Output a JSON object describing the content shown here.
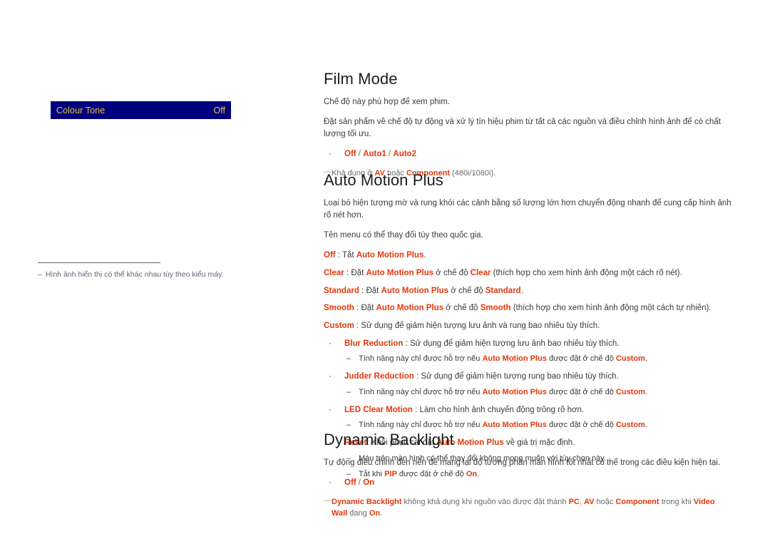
{
  "osd": {
    "label": "Colour Tone",
    "value": "Off",
    "bg_color": "#00007f",
    "text_color": "#e8c23c"
  },
  "left_note": {
    "marker": "–",
    "text": "Hình ảnh hiển thị có thể khác nhau tùy theo kiểu máy."
  },
  "accent_colors": {
    "red": "#e3380c",
    "grey": "#6a6a6a",
    "menu_blue": "#00007f",
    "menu_yellow": "#e8c23c"
  },
  "sections": {
    "film_mode": {
      "title": "Film Mode",
      "p1": "Chế độ này phù hợp để xem phim.",
      "p2": "Đặt sản phẩm về chế độ tự động và xử lý tín hiệu phim từ tất cả các nguồn và điều chỉnh hình ảnh để có chất lượng tối ưu.",
      "bullet_marker": "·",
      "options": {
        "o1": "Off",
        "sep1": " / ",
        "o2": "Auto1",
        "sep2": " / ",
        "o3": "Auto2"
      },
      "footnote": {
        "marker": "—",
        "t1": "Khả dụng ở ",
        "k1": "AV",
        "t2": " hoặc ",
        "k2": "Component",
        "t3": " (480i/1080i)."
      }
    },
    "auto_motion_plus": {
      "title": "Auto Motion Plus",
      "p1": "Loại bỏ hiện tượng mờ và rung khỏi các cảnh bằng số lượng lớn hơn chuyển động nhanh để cung cấp hình ảnh rõ nét hơn.",
      "p2": "Tên menu có thể thay đổi tùy theo quốc gia.",
      "defs": {
        "off": {
          "key": "Off",
          "sep": " : ",
          "t1": "Tắt ",
          "k1": "Auto Motion Plus",
          "t2": "."
        },
        "clear": {
          "key": "Clear",
          "sep": " : ",
          "t1": "Đặt ",
          "k1": "Auto Motion Plus",
          "t2": " ở chế độ ",
          "k2": "Clear",
          "t3": " (thích hợp cho xem hình ảnh động một cách rõ nét)."
        },
        "standard": {
          "key": "Standard",
          "sep": " : ",
          "t1": "Đặt ",
          "k1": "Auto Motion Plus",
          "t2": " ở chế độ ",
          "k2": "Standard",
          "t3": "."
        },
        "smooth": {
          "key": "Smooth",
          "sep": " : ",
          "t1": "Đặt ",
          "k1": "Auto Motion Plus",
          "t2": " ở chế độ ",
          "k2": "Smooth",
          "t3": " (thích hợp cho xem hình ảnh động một cách tự nhiên)."
        },
        "custom": {
          "key": "Custom",
          "sep": " : ",
          "t1": "Sử dụng để giảm hiện tượng lưu ảnh và rung bao nhiêu tùy thích."
        }
      },
      "bullet_marker": "·",
      "dash_marker": "–",
      "sub_items": {
        "blur": {
          "key": "Blur Reduction",
          "sep": " : ",
          "text": "Sử dụng để giảm hiện tượng lưu ảnh bao nhiêu tùy thích."
        },
        "judder": {
          "key": "Judder Reduction",
          "sep": " : ",
          "text": "Sử dụng để giảm hiện tượng rung bao nhiêu tùy thích."
        },
        "led": {
          "key": "LED Clear Motion",
          "sep": " : ",
          "text": "Làm cho hình ảnh chuyển động trông rõ hơn."
        },
        "reset": {
          "key": "Reset",
          "sep": ": ",
          "t1": "Khôi phục cài đặt ",
          "k1": "Auto Motion Plus",
          "t2": " về giá trị mặc định."
        }
      },
      "notes": {
        "custom_support": {
          "t1": "Tính năng này chỉ được hỗ trợ nếu ",
          "k1": "Auto Motion Plus",
          "t2": " được đặt ở chế độ ",
          "k2": "Custom",
          "t3": "."
        },
        "colour_change": {
          "text": "Màu trên màn hình có thể thay đổi không mong muốn với tùy chọn này."
        },
        "pip_off": {
          "t1": "Tắt khi ",
          "k1": "PIP",
          "t2": " được đặt ở chế độ ",
          "k2": "On",
          "t3": "."
        }
      }
    },
    "dynamic_backlight": {
      "title": "Dynamic Backlight",
      "p1": "Tự động điều chỉnh đèn nền để mang lại độ tương phản màn hình tốt nhất có thể trong các điều kiện hiện tại.",
      "bullet_marker": "·",
      "options": {
        "o1": "Off",
        "sep1": " / ",
        "o2": "On"
      },
      "footnote": {
        "marker": "—",
        "k1": "Dynamic Backlight",
        "t1": " không khả dụng khi nguồn vào được đặt thành ",
        "k2": "PC",
        "t2": ", ",
        "k3": "AV",
        "t3": " hoặc ",
        "k4": "Component",
        "t4": " trong khi ",
        "k5": "Video Wall",
        "t5": " đang ",
        "k6": "On",
        "t6": "."
      }
    }
  }
}
